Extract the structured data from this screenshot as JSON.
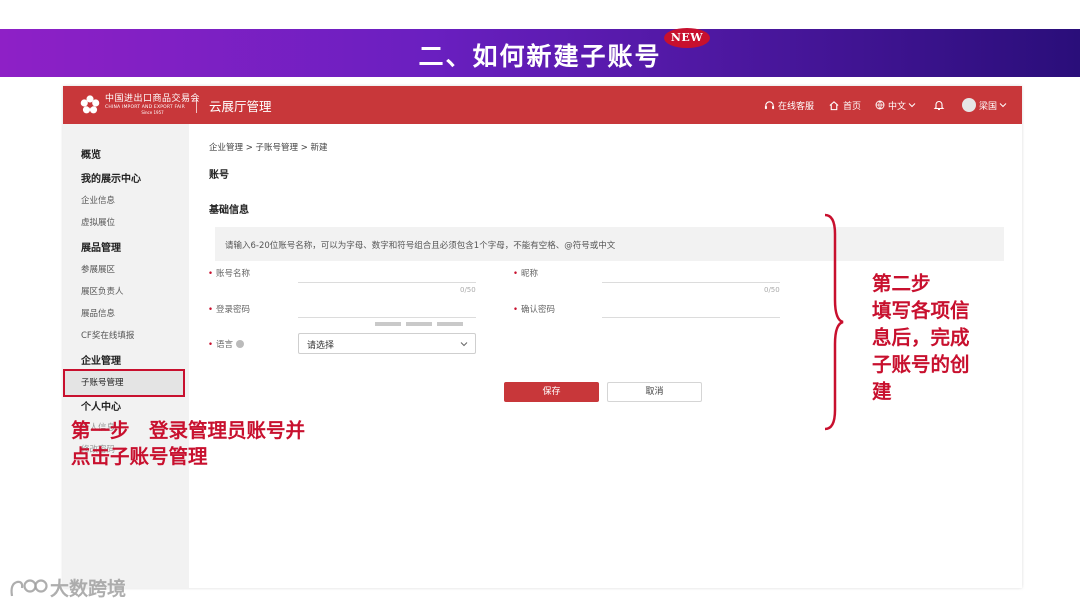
{
  "slide": {
    "title": "二、如何新建子账号",
    "badge": "NEW"
  },
  "topbar": {
    "logo": {
      "cn": "中国进出口商品交易会",
      "en": "CHINA IMPORT AND EXPORT FAIR",
      "since": "Since 1957"
    },
    "app_title": "云展厅管理",
    "items": {
      "support": "在线客服",
      "home": "首页",
      "language": "中文",
      "user": "梁国"
    }
  },
  "sidebar": {
    "overview": "概览",
    "group_showcase": "我的展示中心",
    "company_info": "企业信息",
    "virtual_booth": "虚拟展位",
    "group_exhibits": "展品管理",
    "exhibit_zone": "参展展区",
    "zone_manager": "展区负责人",
    "exhibit_info": "展品信息",
    "cf_award": "CF奖在线填报",
    "group_company": "企业管理",
    "sub_account": "子账号管理",
    "group_personal": "个人中心",
    "personal_info": "个人信息",
    "change_password": "修改密码"
  },
  "main": {
    "breadcrumb": "企业管理 > 子账号管理 > 新建",
    "section_account": "账号",
    "section_basic": "基础信息",
    "notice": "请输入6-20位账号名称，可以为字母、数字和符号组合且必须包含1个字母，不能有空格、@符号或中文",
    "fields": {
      "account_name": "账号名称",
      "nickname": "昵称",
      "password": "登录密码",
      "confirm_password": "确认密码",
      "language": "语言"
    },
    "counter_account": "0/50",
    "counter_nickname": "0/50",
    "language_placeholder": "请选择",
    "save": "保存",
    "cancel": "取消"
  },
  "annotations": {
    "step1_line1": "第一步　登录管理员账号并",
    "step1_line2": "点击子账号管理",
    "step2_lines": [
      "第二步",
      "填写各项信",
      "息后，完成",
      "子账号的创",
      "建"
    ]
  },
  "watermark": "大数跨境",
  "colors": {
    "banner_start": "#8e20c6",
    "banner_end": "#2a0e7a",
    "brand_red": "#c8373a",
    "annotation_red": "#c8102e"
  }
}
